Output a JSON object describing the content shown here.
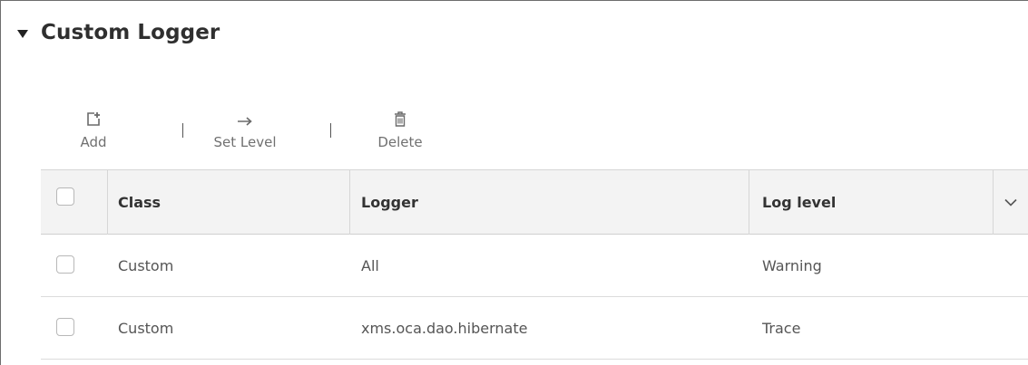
{
  "section": {
    "title": "Custom Logger",
    "caret_icon": "caret-down-icon"
  },
  "toolbar": {
    "add_label": "Add",
    "add_icon": "add-icon",
    "set_level_label": "Set Level",
    "set_level_icon": "arrow-right-icon",
    "delete_label": "Delete",
    "delete_icon": "trash-icon"
  },
  "table": {
    "columns": [
      "Class",
      "Logger",
      "Log level"
    ],
    "rows": [
      {
        "class": "Custom",
        "logger": "All",
        "log_level": "Warning"
      },
      {
        "class": "Custom",
        "logger": "xms.oca.dao.hibernate",
        "log_level": "Trace"
      }
    ],
    "column_menu_icon": "chevron-down-icon"
  }
}
